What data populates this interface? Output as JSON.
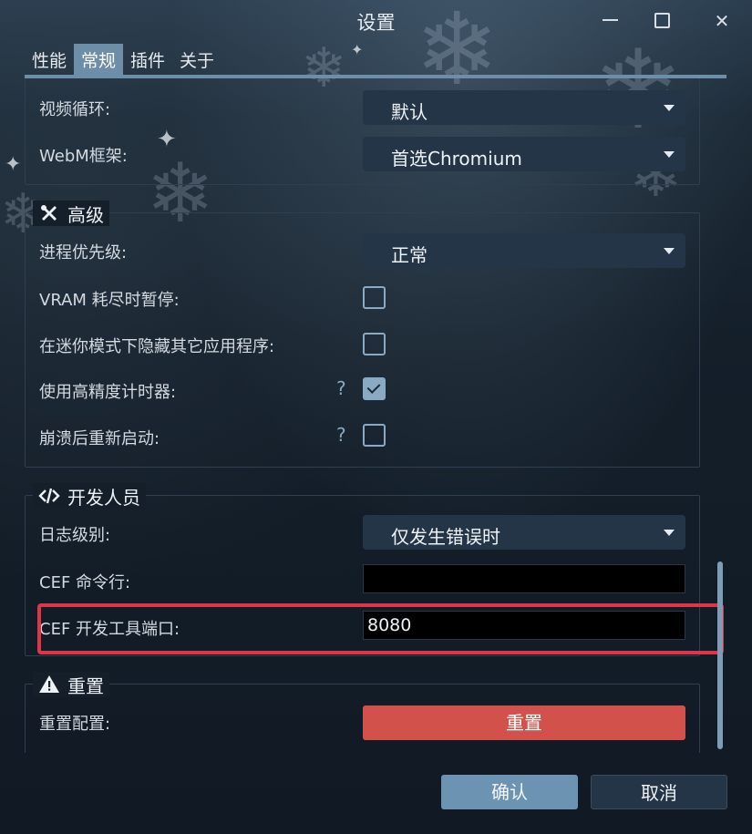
{
  "window": {
    "title": "设置",
    "controls": {
      "minimize_icon": "minimize-icon",
      "maximize_icon": "maximize-icon",
      "close_icon": "close-icon"
    }
  },
  "tabs": [
    {
      "label": "性能",
      "active": false
    },
    {
      "label": "常规",
      "active": true
    },
    {
      "label": "插件",
      "active": false
    },
    {
      "label": "关于",
      "active": false
    }
  ],
  "video": {
    "loop_label": "视频循环:",
    "loop_value": "默认",
    "webm_label": "WebM框架:",
    "webm_value": "首选Chromium"
  },
  "advanced": {
    "title": "高级",
    "icon": "tools-icon",
    "priority_label": "进程优先级:",
    "priority_value": "正常",
    "vram_label": "VRAM 耗尽时暂停:",
    "vram_checked": false,
    "hide_apps_label": "在迷你模式下隐藏其它应用程序:",
    "hide_apps_checked": false,
    "hires_timer_label": "使用高精度计时器:",
    "hires_timer_checked": true,
    "restart_label": "崩溃后重新启动:",
    "restart_checked": false,
    "help_symbol": "?"
  },
  "developer": {
    "title": "开发人员",
    "icon": "code-icon",
    "log_label": "日志级别:",
    "log_value": "仅发生错误时",
    "cef_cmd_label": "CEF 命令行:",
    "cef_cmd_value": "",
    "cef_port_label": "CEF 开发工具端口:",
    "cef_port_value": "8080"
  },
  "reset": {
    "title": "重置",
    "icon": "warning-icon",
    "config_label": "重置配置:",
    "button_label": "重置"
  },
  "footer": {
    "ok_label": "确认",
    "cancel_label": "取消"
  },
  "colors": {
    "accent": "#6c8ea8",
    "reset_button": "#d2514a",
    "highlight_box": "#e0344a"
  }
}
